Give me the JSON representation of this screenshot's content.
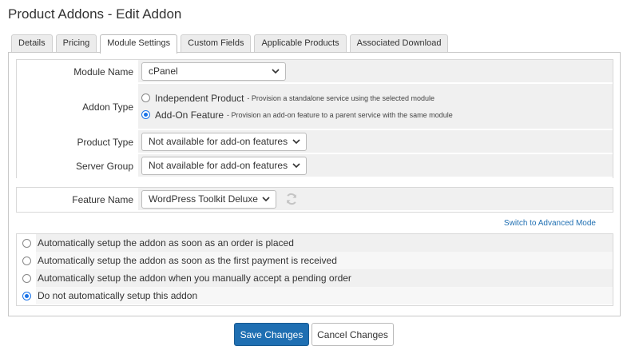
{
  "page": {
    "title": "Product Addons - Edit Addon"
  },
  "tabs": [
    {
      "label": "Details",
      "active": false
    },
    {
      "label": "Pricing",
      "active": false
    },
    {
      "label": "Module Settings",
      "active": true
    },
    {
      "label": "Custom Fields",
      "active": false
    },
    {
      "label": "Applicable Products",
      "active": false
    },
    {
      "label": "Associated Download",
      "active": false
    }
  ],
  "module": {
    "module_name_label": "Module Name",
    "module_name_value": "cPanel",
    "addon_type_label": "Addon Type",
    "addon_type_options": [
      {
        "label": "Independent Product",
        "description": "- Provision a standalone service using the selected module",
        "selected": false
      },
      {
        "label": "Add-On Feature",
        "description": "- Provision an add-on feature to a parent service with the same module",
        "selected": true
      }
    ],
    "product_type_label": "Product Type",
    "product_type_value": "Not available for add-on features",
    "server_group_label": "Server Group",
    "server_group_value": "Not available for add-on features"
  },
  "feature": {
    "label": "Feature Name",
    "value": "WordPress Toolkit Deluxe",
    "refresh_icon": "refresh-icon"
  },
  "advanced_link": "Switch to Advanced Mode",
  "auto_setup": [
    {
      "label": "Automatically setup the addon as soon as an order is placed",
      "selected": false
    },
    {
      "label": "Automatically setup the addon as soon as the first payment is received",
      "selected": false
    },
    {
      "label": "Automatically setup the addon when you manually accept a pending order",
      "selected": false
    },
    {
      "label": "Do not automatically setup this addon",
      "selected": true
    }
  ],
  "buttons": {
    "save": "Save Changes",
    "cancel": "Cancel Changes"
  },
  "colors": {
    "primary": "#1f6fb2",
    "radio_selected": "#1a73e8",
    "row_bg": "#f0f0f0"
  }
}
